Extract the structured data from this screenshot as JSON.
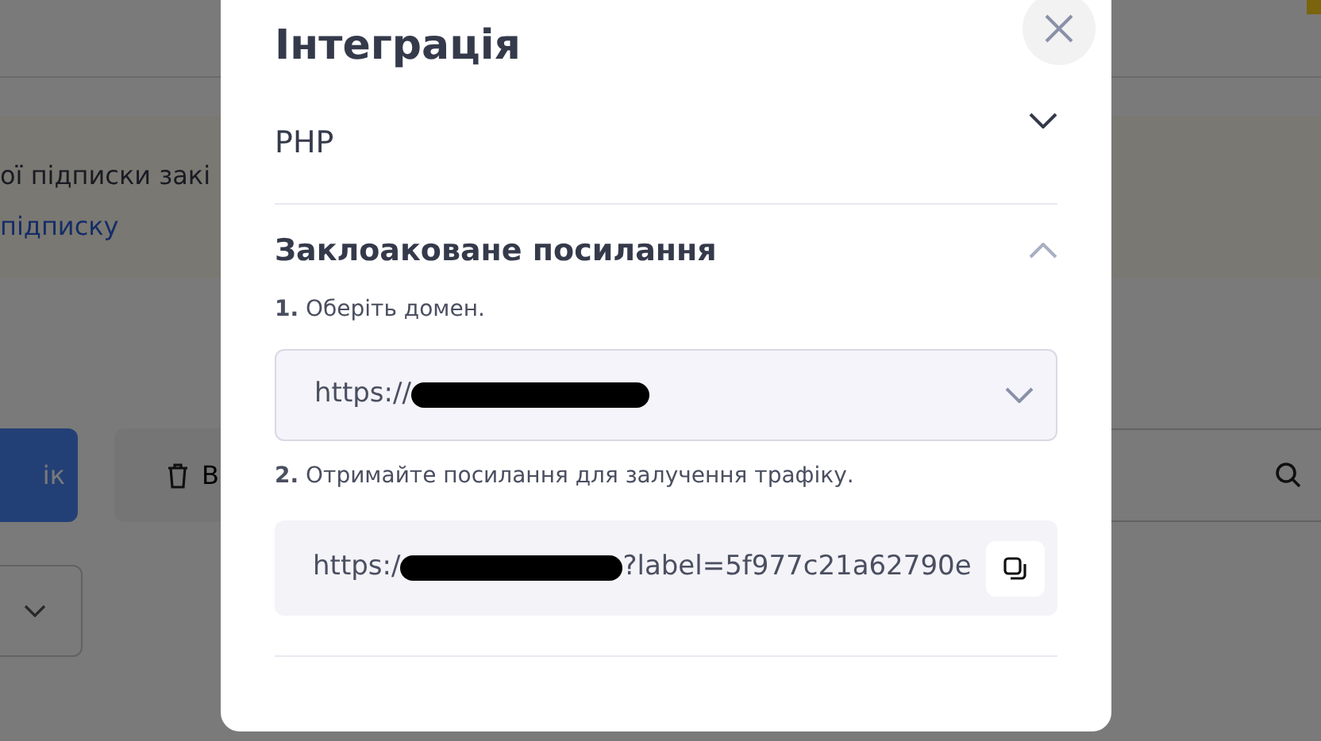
{
  "page": {
    "notice_text": "ої підписки закі",
    "notice_link": "підписку",
    "primary_button": "ік",
    "secondary_button": "В"
  },
  "modal": {
    "title": "Інтеграція",
    "sections": [
      {
        "title": "PHP",
        "expanded": false
      },
      {
        "title": "Заклоаковане посилання",
        "expanded": true,
        "steps": [
          {
            "number": "1.",
            "text": "Оберіть домен.",
            "kind": "select",
            "value": "https://"
          },
          {
            "number": "2.",
            "text": "Отримайте посилання для залучення трафіку.",
            "kind": "link",
            "prefix": "https:/",
            "suffix": "?label=5f977c21a62790e"
          }
        ]
      }
    ]
  }
}
